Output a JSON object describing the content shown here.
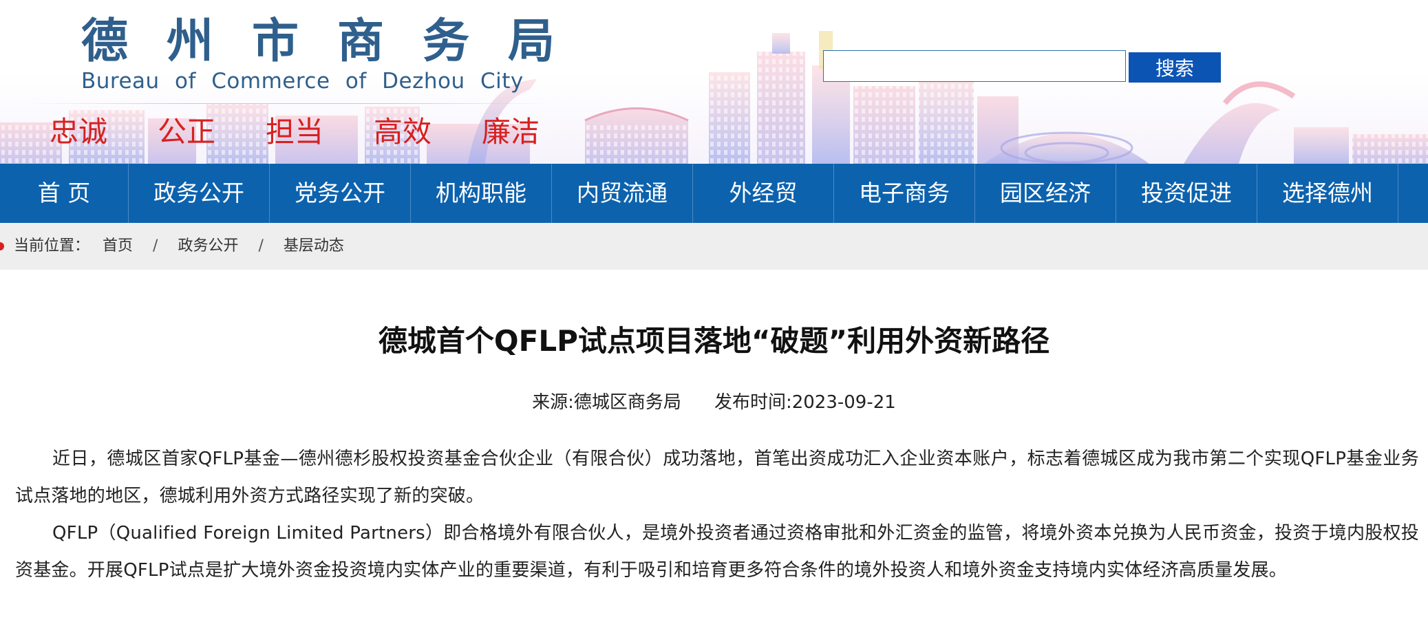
{
  "header": {
    "title_cn": "德州市商务局",
    "title_en": "Bureau of Commerce of Dezhou City",
    "motto": [
      "忠诚",
      "公正",
      "担当",
      "高效",
      "廉洁"
    ],
    "colors": {
      "title": "#2f5f8c",
      "motto": "#d7201f",
      "nav": "#0d62ad",
      "search_button": "#0c54b4"
    }
  },
  "search": {
    "value": "",
    "placeholder": "",
    "button_label": "搜索"
  },
  "nav": {
    "items": [
      "首 页",
      "政务公开",
      "党务公开",
      "机构职能",
      "内贸流通",
      "外经贸",
      "电子商务",
      "园区经济",
      "投资促进",
      "选择德州"
    ]
  },
  "breadcrumb": {
    "prefix": "当前位置：",
    "items": [
      "首页",
      "政务公开",
      "基层动态"
    ],
    "separator": "/"
  },
  "article": {
    "title": "德城首个QFLP试点项目落地“破题”利用外资新路径",
    "source": "来源:德城区商务局",
    "published": "发布时间:2023-09-21",
    "paragraphs": [
      "近日，德城区首家QFLP基金—德州德杉股权投资基金合伙企业（有限合伙）成功落地，首笔出资成功汇入企业资本账户，标志着德城区成为我市第二个实现QFLP基金业务试点落地的地区，德城利用外资方式路径实现了新的突破。",
      "QFLP（Qualified Foreign Limited Partners）即合格境外有限合伙人，是境外投资者通过资格审批和外汇资金的监管，将境外资本兑换为人民币资金，投资于境内股权投资基金。开展QFLP试点是扩大境外资金投资境内实体产业的重要渠道，有利于吸引和培育更多符合条件的境外投资人和境外资金支持境内实体经济高质量发展。"
    ]
  }
}
